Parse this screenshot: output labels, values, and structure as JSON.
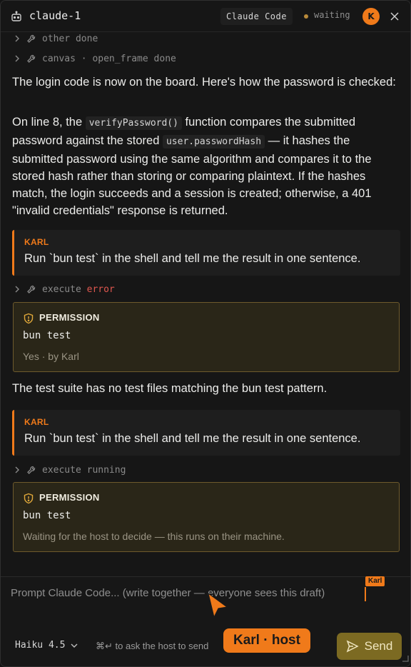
{
  "header": {
    "title": "claude-1",
    "agent": "Claude Code",
    "status": "waiting",
    "avatar_initial": "K"
  },
  "transcript": {
    "tool_other": {
      "name": "other",
      "status": "done"
    },
    "tool_canvas": {
      "name": "canvas · open_frame",
      "status": "done"
    },
    "intro": "The login code is now on the board. Here's how the password is checked:",
    "body": {
      "p1": "On line 8, the ",
      "code1": "verifyPassword()",
      "p2": " function compares the submitted password against the stored ",
      "code2": "user.passwordHash",
      "p3": " — it hashes the submitted password using the same algorithm and compares it to the stored hash rather than storing or comparing plaintext. If the hashes match, the login succeeds and a session is created; otherwise, a 401 \"invalid credentials\" response is returned."
    },
    "user_msg_1": {
      "author": "KARL",
      "text": "Run `bun test` in the shell and tell me the result in one sentence."
    },
    "tool_execute_1": {
      "name": "execute",
      "status": "error"
    },
    "permission_1": {
      "title": "PERMISSION",
      "command": "bun test",
      "status": "Yes · by Karl"
    },
    "result": "The test suite has no test files matching the bun test pattern.",
    "user_msg_2": {
      "author": "KARL",
      "text": "Run `bun test` in the shell and tell me the result in one sentence."
    },
    "tool_execute_2": {
      "name": "execute",
      "status": "running"
    },
    "permission_2": {
      "title": "PERMISSION",
      "command": "bun test",
      "status": "Waiting for the host to decide — this runs on their machine."
    }
  },
  "composer": {
    "placeholder": "Prompt Claude Code... (write together — everyone sees this draft)",
    "cursor_label": "Karl",
    "model": "Haiku 4.5",
    "hint": "⌘↵ to ask the host to send",
    "host_badge": "Karl · host",
    "send_label": "Send"
  },
  "colors": {
    "accent": "#f07a1a",
    "error": "#e0574f",
    "permission_border": "#6e5a2c",
    "send_bg": "#7c6a22"
  }
}
